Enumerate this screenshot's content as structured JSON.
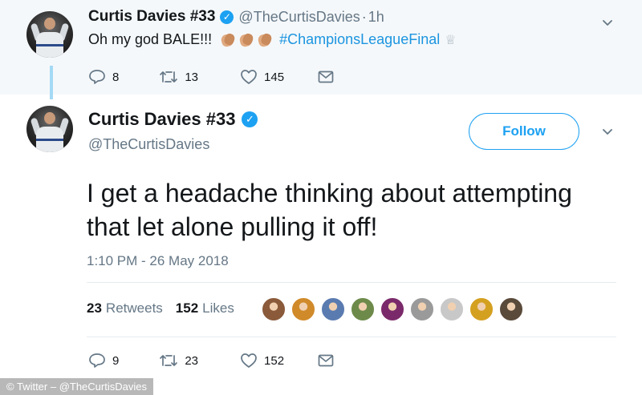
{
  "parent_tweet": {
    "name": "Curtis Davies #33",
    "handle": "@TheCurtisDavies",
    "dot": "·",
    "time": "1h",
    "text_main": "Oh my god BALE!!!",
    "emoji": "clapping-hands-emoji",
    "hashtag": "#ChampionsLeagueFinal",
    "trophy_icon": "trophy-icon",
    "replies": "8",
    "retweets": "13",
    "likes": "145"
  },
  "main_tweet": {
    "name": "Curtis Davies #33",
    "handle": "@TheCurtisDavies",
    "follow_label": "Follow",
    "text": "I get a headache thinking about attempting that let alone pulling it off!",
    "timestamp": "1:10 PM - 26 May 2018",
    "retweet_count": "23",
    "retweet_label": "Retweets",
    "like_count": "152",
    "like_label": "Likes",
    "liker_avatar_colors": [
      "#8a5a3a",
      "#d08a2a",
      "#5a7bb0",
      "#6d8a4a",
      "#7a2a6a",
      "#9a9a9a",
      "#c8c8c8",
      "#d4a020",
      "#5a4a3a"
    ],
    "replies": "9",
    "retweets": "23",
    "likes": "152"
  },
  "footer": {
    "credit": "© Twitter – @TheCurtisDavies"
  },
  "colors": {
    "accent": "#1da1f2",
    "hashtag": "#1b95e0",
    "secondary_text": "#657786",
    "parent_bg": "#f5f8fa",
    "thread_line": "#a4d9f5"
  }
}
